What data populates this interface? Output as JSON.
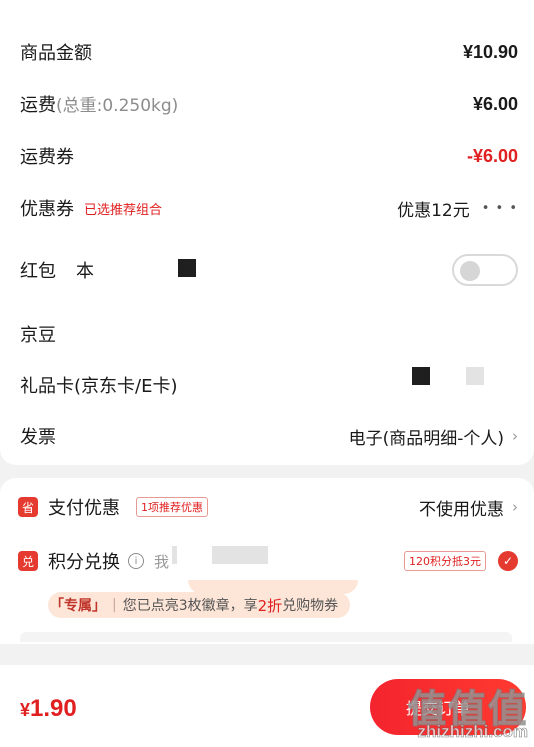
{
  "summary": {
    "goods_amount": {
      "label": "商品金额",
      "value": "¥10.90"
    },
    "shipping": {
      "label": "运费",
      "weight_note": "(总重:0.250kg)",
      "value": "¥6.00"
    },
    "shipping_coupon": {
      "label": "运费券",
      "value": "-¥6.00"
    },
    "coupon": {
      "label": "优惠券",
      "tag": "已选推荐组合",
      "value": "优惠12元",
      "more": "• • •"
    },
    "red_packet": {
      "label": "红包",
      "note": "本",
      "toggle_on": false
    },
    "jd_beans": {
      "label": "京豆"
    },
    "gift_card": {
      "label": "礼品卡(京东卡/E卡)"
    },
    "invoice": {
      "label": "发票",
      "value": "电子(商品明细-个人)",
      "chevron": "›"
    }
  },
  "payment": {
    "pay_discount": {
      "icon": "省",
      "label": "支付优惠",
      "badge": "1项推荐优惠",
      "value": "不使用优惠",
      "chevron": "›"
    },
    "points": {
      "icon": "兑",
      "label": "积分兑换",
      "info": "i",
      "note": "我",
      "badge": "120积分抵3元",
      "checked": true,
      "check": "✓"
    },
    "promo": {
      "exclusive": "「专属」",
      "sep": "|",
      "text_before": "您已点亮3枚徽章，享",
      "highlight": "2折",
      "text_after": "兑购物券"
    }
  },
  "bottom": {
    "currency": "¥",
    "amount": "1.90",
    "submit_label": "提交订单",
    "watermark": "值值值",
    "watermark_url": "zhizhizhi.com"
  },
  "colors": {
    "accent": "#e53a2f",
    "price_red": "#e02020"
  }
}
